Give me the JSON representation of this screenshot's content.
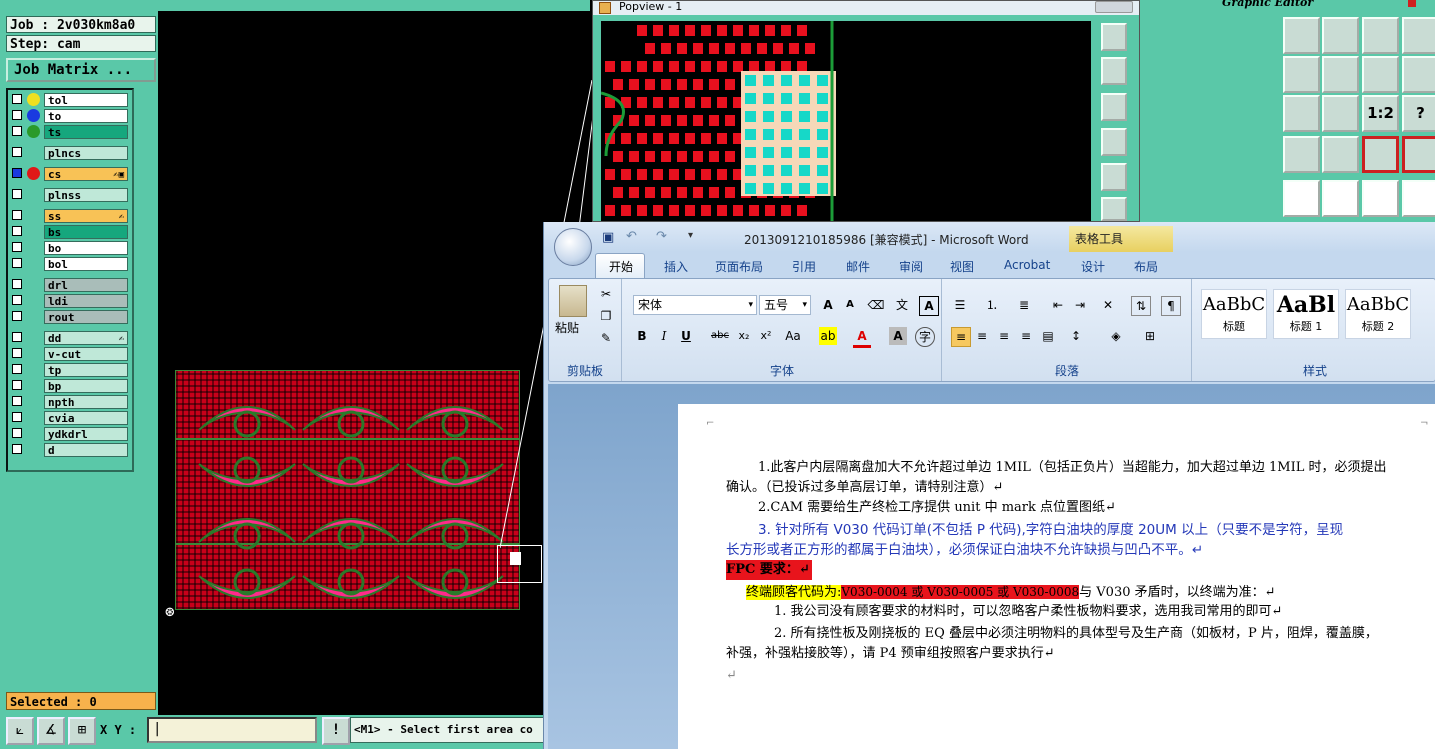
{
  "genesis": {
    "job_label": "Job : 2v030km8a0",
    "step_label": "Step: cam",
    "job_matrix": "Job Matrix ...",
    "layers": [
      {
        "name": "tol",
        "color": "w",
        "mark": ""
      },
      {
        "name": "to",
        "color": "w",
        "mark": ""
      },
      {
        "name": "ts",
        "color": "g",
        "mark": ""
      },
      {
        "name": "plncs",
        "color": "t",
        "mark": ""
      },
      {
        "name": "cs",
        "color": "y",
        "mark": "✍▣"
      },
      {
        "name": "plnss",
        "color": "t",
        "mark": ""
      },
      {
        "name": "ss",
        "color": "y",
        "mark": "✍"
      },
      {
        "name": "bs",
        "color": "g",
        "mark": ""
      },
      {
        "name": "bo",
        "color": "w",
        "mark": ""
      },
      {
        "name": "bol",
        "color": "w",
        "mark": ""
      },
      {
        "name": "drl",
        "color": "gr",
        "mark": ""
      },
      {
        "name": "ldi",
        "color": "gr",
        "mark": ""
      },
      {
        "name": "rout",
        "color": "gr",
        "mark": ""
      },
      {
        "name": "dd",
        "color": "t",
        "mark": "✍"
      },
      {
        "name": "v-cut",
        "color": "t",
        "mark": ""
      },
      {
        "name": "tp",
        "color": "t",
        "mark": ""
      },
      {
        "name": "bp",
        "color": "t",
        "mark": ""
      },
      {
        "name": "npth",
        "color": "t",
        "mark": ""
      },
      {
        "name": "cvia",
        "color": "t",
        "mark": ""
      },
      {
        "name": "ydkdrl",
        "color": "t",
        "mark": ""
      },
      {
        "name": "d",
        "color": "t",
        "mark": ""
      }
    ],
    "selected": "Selected : 0",
    "xy_label": "X Y :",
    "xy_value": "",
    "bang": "!",
    "message": "<M1> - Select first area co"
  },
  "popview": {
    "title": "Popview - 1"
  },
  "graphic_editor": {
    "title": "Graphic Editor"
  },
  "word": {
    "title": "2013091210185986 [兼容模式] - Microsoft Word",
    "contextual_tab": "表格工具",
    "tabs": [
      "开始",
      "插入",
      "页面布局",
      "引用",
      "邮件",
      "审阅",
      "视图",
      "Acrobat",
      "设计",
      "布局"
    ],
    "paste_label": "粘贴",
    "font_name": "宋体",
    "font_size": "五号",
    "groups": {
      "clipboard": "剪贴板",
      "font": "字体",
      "paragraph": "段落",
      "styles": "样式"
    },
    "styles": [
      {
        "preview": "AaBbC",
        "name": "标题"
      },
      {
        "preview": "AaBl",
        "name": "标题 1"
      },
      {
        "preview": "AaBbC",
        "name": "标题 2"
      }
    ],
    "paragraphs": {
      "p1a": "1.此客户内层隔离盘加大不允许超过单边 1MIL（包括正负片）当超能力，加大超过单边 1MIL 时，必须提出",
      "p1b": "确认。（已投诉过多单高层订单，请特别注意）↵",
      "p2": "2.CAM 需要给生产终检工序提供 unit 中 mark 点位置图纸↵",
      "p3a": "3.  针对所有 V030 代码订单(不包括 P 代码),字符白油块的厚度 20UM 以上（只要不是字符，呈现",
      "p3b": "长方形或者正方形的都属于白油块），必须保证白油块不允许缺损与凹凸不平。↵",
      "fpc": "FPC 要求：↵",
      "code_lead": "终端顾客代码为:",
      "code_list": "V030-0004 或 V030-0005 或 V030-0008",
      "code_tail": "与 V030 矛盾时，以终端为准：↵",
      "s1": "1.  我公司没有顾客要求的材料时，可以忽略客户柔性板物料要求，选用我司常用的即可↵",
      "s2a": "2.  所有挠性板及刚挠板的 EQ 叠层中必须注明物料的具体型号及生产商（如板材，P 片，阻焊，覆盖膜，",
      "s2b": "补强，补强粘接胶等），请 P4 预审组按照客户要求执行↵",
      "end": "↵"
    }
  }
}
